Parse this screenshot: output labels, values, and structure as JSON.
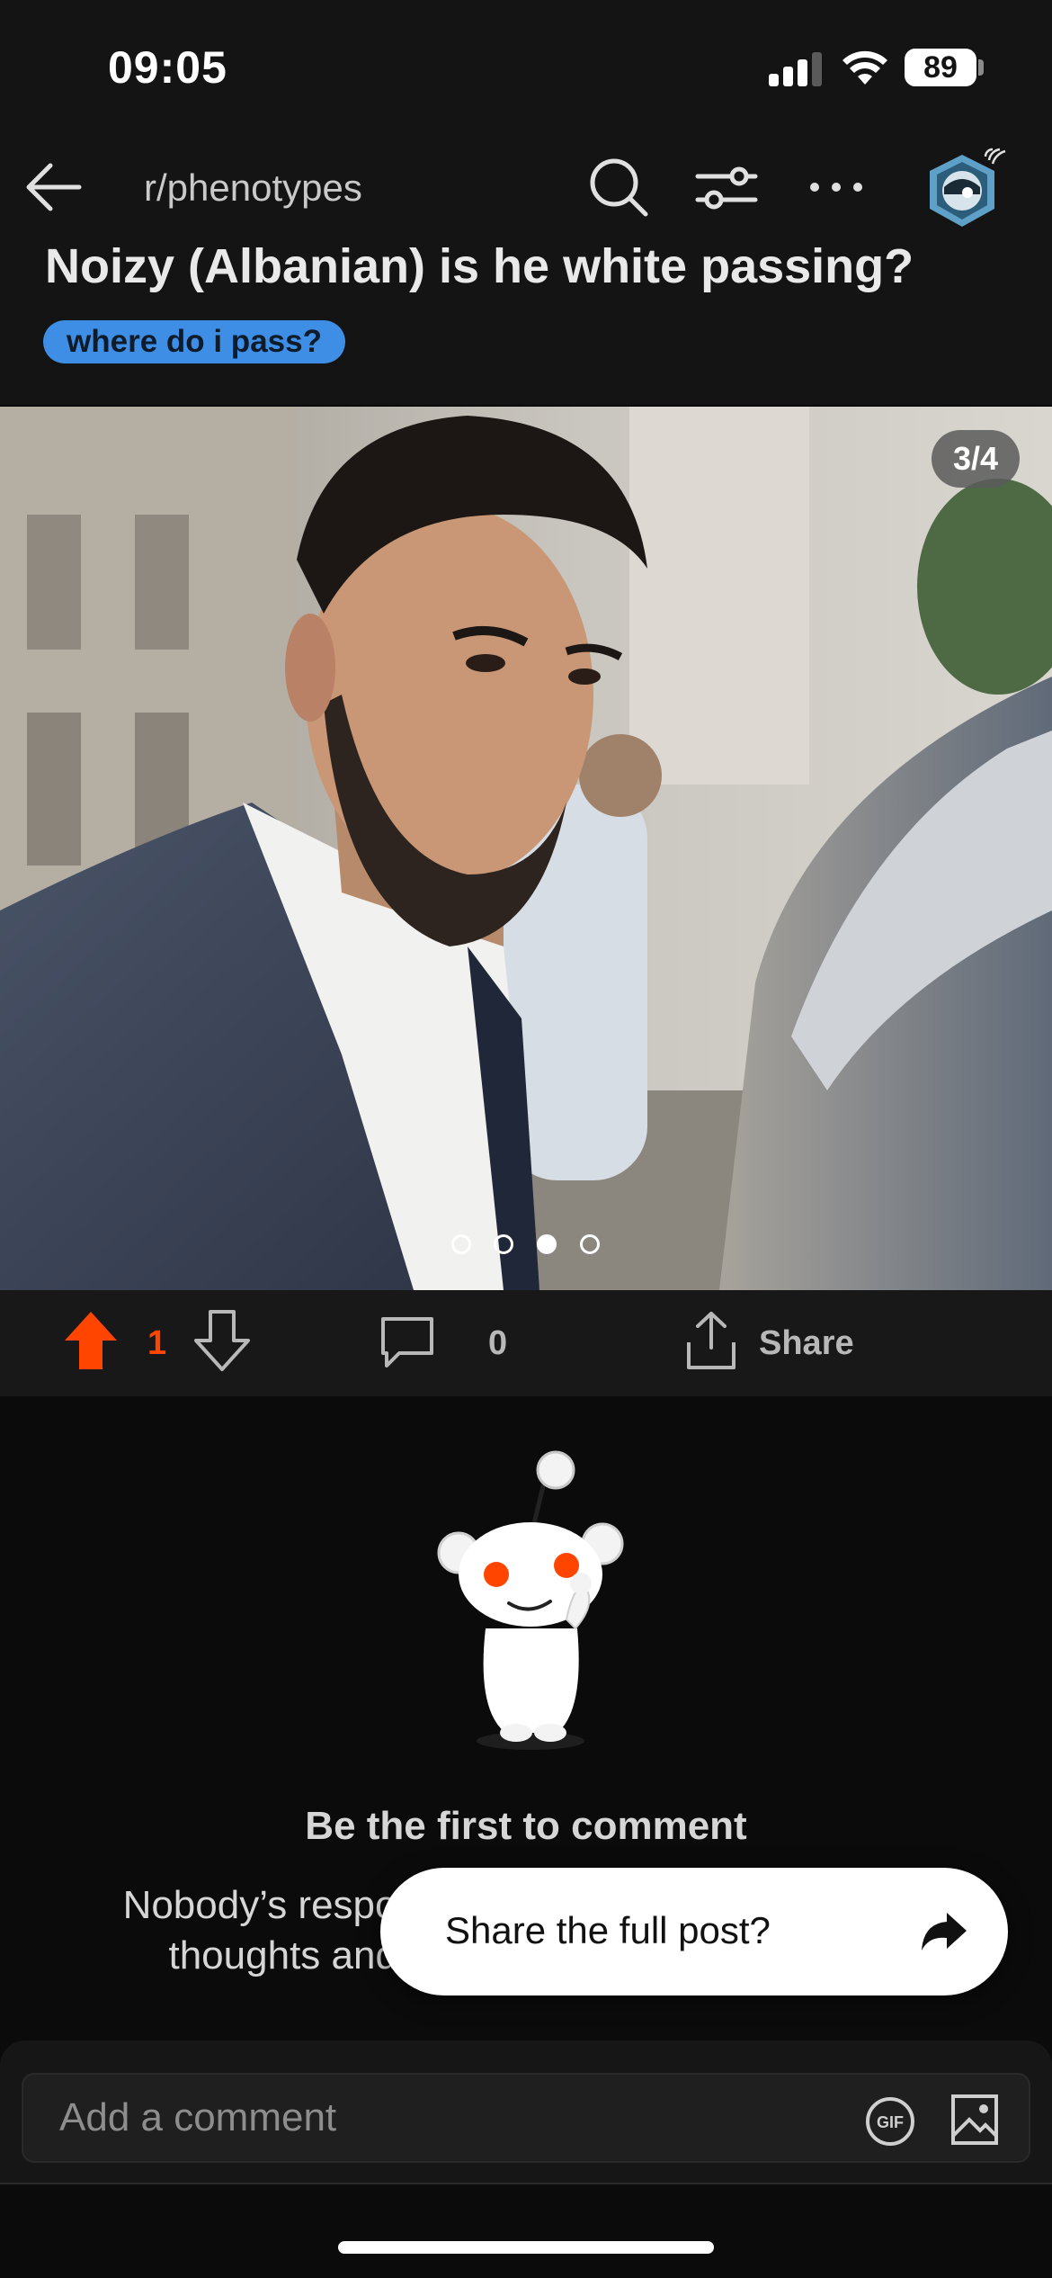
{
  "status_bar": {
    "time": "09:05",
    "battery": "89"
  },
  "header": {
    "subreddit": "r/phenotypes",
    "icons": [
      "back-arrow-icon",
      "search-icon",
      "filter-icon",
      "more-icon",
      "avatar"
    ]
  },
  "post": {
    "title": "Noizy (Albanian) is he white passing?",
    "flair": "where do i pass?",
    "flair_color": "#3f8ee6",
    "gallery": {
      "counter": "3/4",
      "current": 3,
      "total": 4
    }
  },
  "actions": {
    "vote_count": "1",
    "upvoted": true,
    "upvote_color": "#ff4500",
    "comment_count": "0",
    "share_label": "Share"
  },
  "comments_empty": {
    "title": "Be the first to comment",
    "body": "Nobody’s responded to this post yet. Add your thoughts and get the conversation going."
  },
  "share_popup": {
    "text": "Share the full post?"
  },
  "composer": {
    "placeholder": "Add a comment",
    "gif_label": "GIF"
  }
}
